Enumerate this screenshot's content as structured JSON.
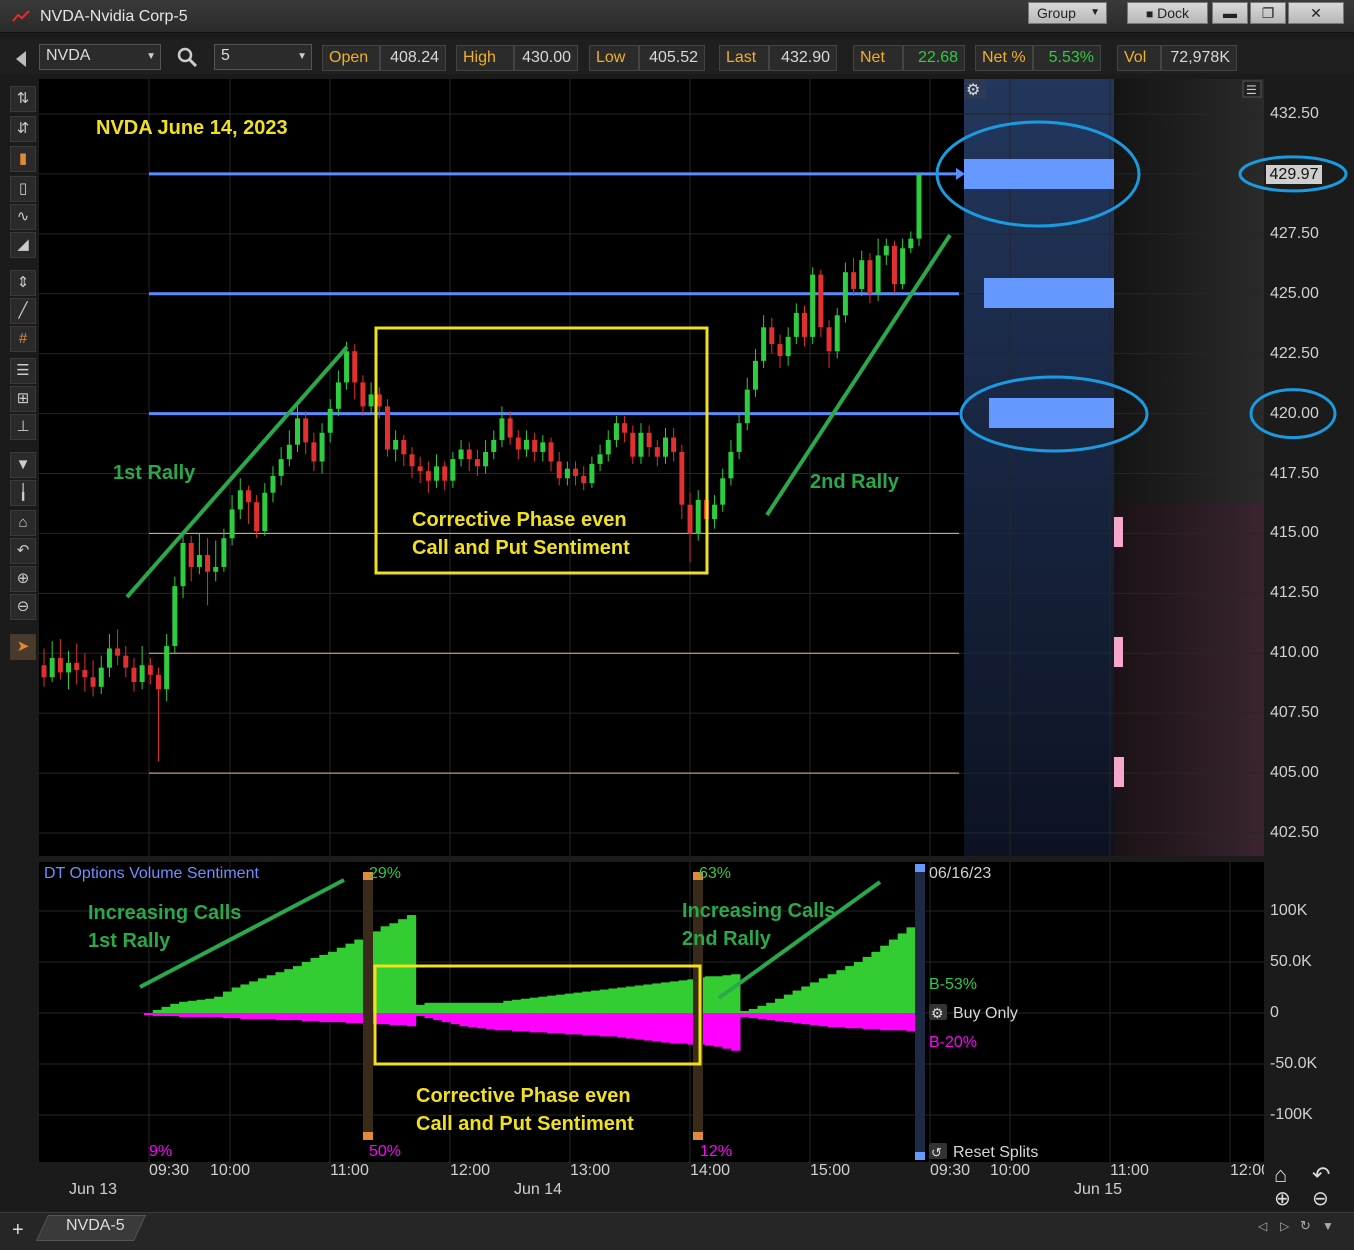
{
  "window": {
    "title": "NVDA-Nvidia Corp-5",
    "group_label": "Group",
    "dock_label": "Dock",
    "minimize_label": "▬",
    "restore_label": "❐",
    "close_label": "✕"
  },
  "quote": {
    "symbol": "NVDA",
    "interval": "5",
    "open_label": "Open",
    "open": "408.24",
    "high_label": "High",
    "high": "430.00",
    "low_label": "Low",
    "low": "405.52",
    "last_label": "Last",
    "last": "432.90",
    "net_label": "Net",
    "net": "22.68",
    "netpct_label": "Net %",
    "netpct": "5.53%",
    "vol_label": "Vol",
    "vol": "72,978K"
  },
  "colors": {
    "up": "#2ecc40",
    "down": "#e03030",
    "annotation_green": "#2aa84a",
    "annotation_yellow": "#f0e020",
    "level_blue": "#5b8cff",
    "ellipse_cyan": "#1a9be0",
    "magenta": "#ff00ff"
  },
  "price_axis": [
    "432.50",
    "427.50",
    "425.00",
    "422.50",
    "420.00",
    "417.50",
    "415.00",
    "412.50",
    "410.00",
    "407.50",
    "405.00",
    "402.50"
  ],
  "price_marker": "429.97",
  "price_marker_420": "420.00",
  "annotations": {
    "title": "NVDA June 14, 2023",
    "rally1": "1st Rally",
    "rally2": "2nd Rally",
    "corrective_line1": "Corrective Phase even",
    "corrective_line2": "Call and Put Sentiment",
    "inc_calls_1a": "Increasing Calls",
    "inc_calls_1b": "1st Rally",
    "inc_calls_2a": "Increasing Calls",
    "inc_calls_2b": "2nd Rally",
    "corr2_line1": "Corrective Phase even",
    "corr2_line2": "Call and Put Sentiment"
  },
  "volume_panel": {
    "title": "DT Options Volume Sentiment",
    "pct_29": "29%",
    "pct_63": "63%",
    "pct_9": "9%",
    "pct_50": "50%",
    "pct_12": "12%",
    "date": "06/16/23",
    "b53": "B-53%",
    "b20": "B-20%",
    "buy_only": "Buy Only",
    "reset_splits": "Reset Splits",
    "axis": [
      "100K",
      "50.0K",
      "0",
      "-50.0K",
      "-100K"
    ]
  },
  "time_axis": {
    "times": [
      "09:30",
      "10:00",
      "11:00",
      "12:00",
      "13:00",
      "14:00",
      "15:00",
      "09:30",
      "10:00",
      "11:00",
      "12:00"
    ],
    "days": [
      "Jun 13",
      "Jun 14",
      "Jun 15"
    ]
  },
  "tab": {
    "label": "NVDA-5",
    "add": "+"
  },
  "chart_data": {
    "type": "candlestick",
    "title": "NVDA June 14, 2023",
    "interval_minutes": 5,
    "ylim": [
      401.5,
      433.5
    ],
    "levels": [
      429.97,
      425.0,
      420.0
    ],
    "minor_levels": [
      415.0,
      410.0,
      405.0
    ],
    "candles": [
      [
        409.5,
        409.0,
        410.2,
        408.6
      ],
      [
        409.0,
        409.8,
        410.5,
        408.8
      ],
      [
        409.8,
        409.2,
        410.6,
        408.9
      ],
      [
        409.2,
        409.6,
        410.1,
        408.5
      ],
      [
        409.6,
        409.3,
        410.4,
        408.7
      ],
      [
        409.3,
        409.0,
        410.0,
        408.4
      ],
      [
        409.0,
        408.6,
        409.7,
        408.2
      ],
      [
        408.6,
        409.4,
        409.9,
        408.3
      ],
      [
        409.4,
        410.2,
        410.8,
        409.0
      ],
      [
        410.2,
        409.9,
        411.0,
        409.5
      ],
      [
        409.9,
        409.4,
        410.3,
        409.0
      ],
      [
        409.4,
        408.8,
        409.8,
        408.4
      ],
      [
        408.8,
        409.5,
        410.3,
        408.5
      ],
      [
        409.5,
        409.1,
        409.8,
        408.7
      ],
      [
        409.1,
        408.5,
        409.4,
        405.5
      ],
      [
        408.5,
        410.3,
        410.8,
        408.0
      ],
      [
        410.3,
        412.8,
        413.2,
        410.0
      ],
      [
        412.8,
        414.6,
        415.0,
        412.3
      ],
      [
        414.6,
        413.6,
        414.9,
        413.0
      ],
      [
        413.6,
        414.1,
        415.0,
        413.3
      ],
      [
        414.1,
        413.4,
        414.8,
        412.0
      ],
      [
        413.4,
        413.6,
        414.7,
        413.0
      ],
      [
        413.6,
        414.8,
        415.2,
        413.4
      ],
      [
        414.8,
        416.0,
        416.6,
        414.5
      ],
      [
        416.0,
        416.8,
        417.3,
        415.6
      ],
      [
        416.8,
        416.3,
        417.0,
        415.4
      ],
      [
        416.3,
        415.1,
        416.6,
        414.8
      ],
      [
        415.1,
        416.7,
        417.1,
        414.9
      ],
      [
        416.7,
        417.4,
        417.8,
        416.3
      ],
      [
        417.4,
        418.1,
        418.6,
        417.0
      ],
      [
        418.1,
        418.7,
        419.3,
        417.8
      ],
      [
        418.7,
        419.8,
        420.3,
        418.4
      ],
      [
        419.8,
        418.8,
        420.1,
        418.3
      ],
      [
        418.8,
        418.0,
        419.2,
        417.6
      ],
      [
        418.0,
        419.2,
        419.6,
        417.5
      ],
      [
        419.2,
        420.2,
        420.6,
        418.8
      ],
      [
        420.2,
        421.3,
        421.8,
        419.9
      ],
      [
        421.3,
        422.6,
        423.0,
        421.0
      ],
      [
        422.6,
        421.3,
        422.9,
        420.6
      ],
      [
        421.3,
        420.3,
        421.6,
        419.9
      ],
      [
        420.3,
        420.8,
        421.3,
        420.0
      ],
      [
        420.8,
        420.3,
        421.1,
        419.8
      ],
      [
        420.3,
        418.5,
        420.6,
        418.2
      ],
      [
        418.5,
        418.9,
        419.3,
        418.0
      ],
      [
        418.9,
        418.3,
        419.1,
        417.8
      ],
      [
        418.3,
        417.8,
        418.6,
        417.3
      ],
      [
        417.8,
        417.6,
        418.2,
        417.1
      ],
      [
        417.6,
        417.2,
        418.0,
        416.7
      ],
      [
        417.2,
        417.8,
        418.3,
        416.9
      ],
      [
        417.8,
        417.2,
        418.0,
        416.8
      ],
      [
        417.2,
        418.1,
        418.4,
        416.9
      ],
      [
        418.1,
        418.5,
        418.9,
        417.8
      ],
      [
        418.5,
        418.1,
        418.8,
        417.6
      ],
      [
        418.1,
        417.8,
        418.5,
        417.4
      ],
      [
        417.8,
        418.4,
        418.9,
        417.5
      ],
      [
        418.4,
        418.9,
        419.3,
        418.1
      ],
      [
        418.9,
        419.8,
        420.3,
        418.6
      ],
      [
        419.8,
        419.0,
        420.1,
        418.7
      ],
      [
        419.0,
        418.5,
        419.3,
        418.1
      ],
      [
        418.5,
        418.9,
        419.3,
        418.2
      ],
      [
        418.9,
        418.4,
        419.2,
        418.0
      ],
      [
        418.4,
        418.8,
        419.1,
        418.0
      ],
      [
        418.8,
        418.0,
        419.0,
        417.6
      ],
      [
        418.0,
        417.3,
        418.4,
        417.0
      ],
      [
        417.3,
        417.7,
        418.0,
        417.0
      ],
      [
        417.7,
        417.4,
        418.0,
        417.0
      ],
      [
        417.4,
        417.1,
        417.8,
        416.8
      ],
      [
        417.1,
        417.9,
        418.2,
        416.9
      ],
      [
        417.9,
        418.3,
        418.7,
        417.6
      ],
      [
        418.3,
        418.9,
        419.3,
        418.0
      ],
      [
        418.9,
        419.6,
        419.9,
        418.6
      ],
      [
        419.6,
        419.2,
        419.9,
        418.8
      ],
      [
        419.2,
        418.2,
        419.5,
        417.9
      ],
      [
        418.2,
        419.2,
        419.6,
        417.9
      ],
      [
        419.2,
        418.6,
        419.5,
        418.2
      ],
      [
        418.6,
        418.2,
        418.9,
        417.8
      ],
      [
        418.2,
        419.0,
        419.4,
        417.9
      ],
      [
        419.0,
        418.4,
        419.4,
        418.0
      ],
      [
        418.4,
        416.2,
        418.7,
        415.6
      ],
      [
        416.2,
        415.0,
        416.7,
        413.8
      ],
      [
        415.0,
        416.4,
        416.8,
        414.7
      ],
      [
        416.4,
        415.6,
        416.7,
        414.8
      ],
      [
        415.6,
        416.2,
        416.6,
        415.2
      ],
      [
        416.2,
        417.3,
        417.7,
        415.9
      ],
      [
        417.3,
        418.4,
        418.9,
        417.0
      ],
      [
        418.4,
        419.6,
        420.0,
        418.1
      ],
      [
        419.6,
        421.0,
        421.5,
        419.3
      ],
      [
        421.0,
        422.2,
        422.7,
        420.7
      ],
      [
        422.2,
        423.6,
        424.1,
        421.9
      ],
      [
        423.6,
        422.9,
        424.0,
        422.5
      ],
      [
        422.9,
        422.4,
        423.3,
        421.9
      ],
      [
        422.4,
        423.2,
        423.6,
        422.0
      ],
      [
        423.2,
        424.2,
        424.6,
        422.9
      ],
      [
        424.2,
        423.2,
        424.5,
        422.8
      ],
      [
        423.2,
        425.8,
        426.1,
        422.9
      ],
      [
        425.8,
        423.6,
        426.0,
        423.2
      ],
      [
        423.6,
        422.6,
        423.9,
        421.9
      ],
      [
        422.6,
        424.1,
        424.4,
        422.3
      ],
      [
        424.1,
        425.9,
        426.3,
        423.8
      ],
      [
        425.9,
        425.2,
        426.5,
        424.9
      ],
      [
        425.2,
        426.4,
        426.8,
        424.9
      ],
      [
        426.4,
        425.0,
        426.7,
        424.6
      ],
      [
        425.0,
        426.6,
        427.3,
        424.7
      ],
      [
        426.6,
        427.0,
        427.3,
        426.2
      ],
      [
        427.0,
        425.4,
        427.2,
        425.0
      ],
      [
        425.4,
        426.9,
        427.3,
        425.2
      ],
      [
        426.9,
        427.3,
        427.6,
        426.7
      ],
      [
        427.3,
        429.97,
        430.0,
        427.0
      ]
    ],
    "volume_sentiment": {
      "calls": [
        0,
        3,
        6,
        9,
        11,
        12,
        13,
        14,
        16,
        21,
        25,
        28,
        31,
        34,
        37,
        40,
        43,
        46,
        50,
        54,
        57,
        60,
        64,
        68,
        72,
        76,
        80,
        85,
        88,
        92,
        96,
        8,
        10,
        10,
        10,
        10,
        10,
        10,
        10,
        10,
        10,
        12,
        13,
        14,
        15,
        16,
        17,
        18,
        19,
        20,
        21,
        22,
        23,
        24,
        25,
        26,
        27,
        28,
        29,
        30,
        31,
        32,
        33,
        35,
        36,
        36,
        37,
        38,
        2,
        4,
        7,
        10,
        14,
        18,
        22,
        26,
        30,
        34,
        38,
        42,
        46,
        50,
        55,
        60,
        66,
        72,
        78,
        84,
        92
      ],
      "puts": [
        -2,
        -3,
        -3,
        -3,
        -4,
        -4,
        -4,
        -4,
        -4,
        -5,
        -5,
        -6,
        -6,
        -6,
        -6,
        -7,
        -7,
        -7,
        -8,
        -8,
        -9,
        -9,
        -9,
        -10,
        -10,
        -11,
        -11,
        -11,
        -12,
        -12,
        -13,
        -3,
        -5,
        -7,
        -9,
        -11,
        -13,
        -14,
        -15,
        -16,
        -17,
        -17,
        -18,
        -18,
        -19,
        -19,
        -20,
        -20,
        -21,
        -21,
        -22,
        -22,
        -23,
        -23,
        -24,
        -25,
        -26,
        -27,
        -28,
        -29,
        -30,
        -30,
        -31,
        -31,
        -32,
        -33,
        -35,
        -37,
        -4,
        -5,
        -6,
        -7,
        -8,
        -9,
        -10,
        -11,
        -12,
        -13,
        -14,
        -14,
        -15,
        -15,
        -16,
        -16,
        -17,
        -17,
        -17,
        -18,
        -18
      ]
    }
  }
}
